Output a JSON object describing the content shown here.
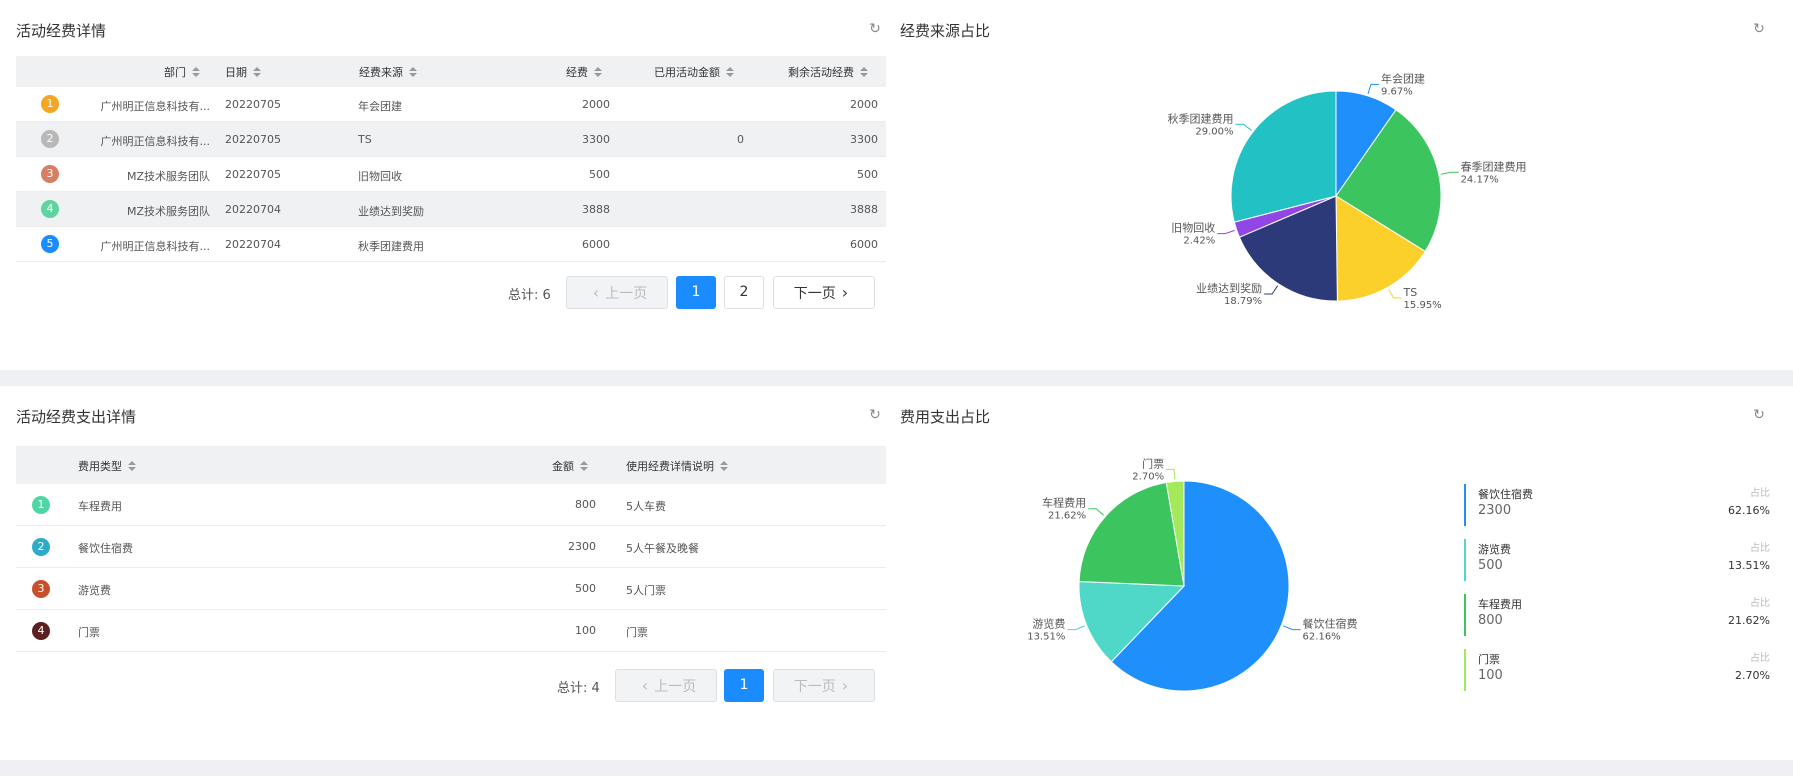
{
  "top_left": {
    "title": "活动经费详情",
    "columns": {
      "dept": "部门",
      "date": "日期",
      "source": "经费来源",
      "amount": "经费",
      "used": "已用活动金额",
      "remain": "剩余活动经费"
    },
    "rows": [
      {
        "index": "1",
        "badge_color": "#f5a623",
        "dept": "广州明正信息科技有...",
        "date": "20220705",
        "source": "年会团建",
        "amount": "2000",
        "used": "",
        "remain": "2000"
      },
      {
        "index": "2",
        "badge_color": "#b8b8b8",
        "dept": "广州明正信息科技有...",
        "date": "20220705",
        "source": "TS",
        "amount": "3300",
        "used": "0",
        "remain": "3300"
      },
      {
        "index": "3",
        "badge_color": "#d77f63",
        "dept": "MZ技术服务团队",
        "date": "20220705",
        "source": "旧物回收",
        "amount": "500",
        "used": "",
        "remain": "500"
      },
      {
        "index": "4",
        "badge_color": "#5fd3a0",
        "dept": "MZ技术服务团队",
        "date": "20220704",
        "source": "业绩达到奖励",
        "amount": "3888",
        "used": "",
        "remain": "3888"
      },
      {
        "index": "5",
        "badge_color": "#1a8cff",
        "dept": "广州明正信息科技有...",
        "date": "20220704",
        "source": "秋季团建费用",
        "amount": "6000",
        "used": "",
        "remain": "6000"
      }
    ],
    "pager": {
      "total": "总计: 6",
      "prev": "上一页",
      "pages": [
        "1",
        "2"
      ],
      "current": "1",
      "next": "下一页"
    }
  },
  "top_right": {
    "title": "经费来源占比"
  },
  "bottom_left": {
    "title": "活动经费支出详情",
    "columns": {
      "type": "费用类型",
      "amount": "金额",
      "desc": "使用经费详情说明"
    },
    "rows": [
      {
        "index": "1",
        "badge_color": "#4fd6a4",
        "type": "车程费用",
        "amount": "800",
        "desc": "5人车费"
      },
      {
        "index": "2",
        "badge_color": "#2eaacb",
        "type": "餐饮住宿费",
        "amount": "2300",
        "desc": "5人午餐及晚餐"
      },
      {
        "index": "3",
        "badge_color": "#c7502a",
        "type": "游览费",
        "amount": "500",
        "desc": "5人门票"
      },
      {
        "index": "4",
        "badge_color": "#5c2020",
        "type": "门票",
        "amount": "100",
        "desc": "门票"
      }
    ],
    "pager": {
      "total": "总计: 4",
      "prev": "上一页",
      "pages": [
        "1"
      ],
      "current": "1",
      "next": "下一页"
    }
  },
  "bottom_right": {
    "title": "费用支出占比",
    "legend_ratio_label": "占比",
    "legend": [
      {
        "name": "餐饮住宿费",
        "value": "2300",
        "ratio": "62.16%",
        "color": "#1f8ffb"
      },
      {
        "name": "游览费",
        "value": "500",
        "ratio": "13.51%",
        "color": "#4fd8c8"
      },
      {
        "name": "车程费用",
        "value": "800",
        "ratio": "21.62%",
        "color": "#3cc45e"
      },
      {
        "name": "门票",
        "value": "100",
        "ratio": "2.70%",
        "color": "#a4e85c"
      }
    ]
  },
  "chart_data": [
    {
      "type": "pie",
      "title": "经费来源占比",
      "slices": [
        {
          "name": "年会团建",
          "value": 9.67,
          "label": "9.67%",
          "color": "#1f8ffb"
        },
        {
          "name": "春季团建费用",
          "value": 24.17,
          "label": "24.17%",
          "color": "#3cc45e"
        },
        {
          "name": "TS",
          "value": 15.95,
          "label": "15.95%",
          "color": "#fcd02a"
        },
        {
          "name": "业绩达到奖励",
          "value": 18.79,
          "label": "18.79%",
          "color": "#2d3a7a"
        },
        {
          "name": "旧物回收",
          "value": 2.42,
          "label": "2.42%",
          "color": "#9146e6"
        },
        {
          "name": "秋季团建费用",
          "value": 29.0,
          "label": "29.00%",
          "color": "#22c2c4"
        }
      ]
    },
    {
      "type": "pie",
      "title": "费用支出占比",
      "slices": [
        {
          "name": "餐饮住宿费",
          "value": 62.16,
          "label": "62.16%",
          "color": "#1f8ffb"
        },
        {
          "name": "游览费",
          "value": 13.51,
          "label": "13.51%",
          "color": "#4fd8c8"
        },
        {
          "name": "车程费用",
          "value": 21.62,
          "label": "21.62%",
          "color": "#3cc45e"
        },
        {
          "name": "门票",
          "value": 2.7,
          "label": "2.70%",
          "color": "#a4e85c"
        }
      ]
    }
  ]
}
